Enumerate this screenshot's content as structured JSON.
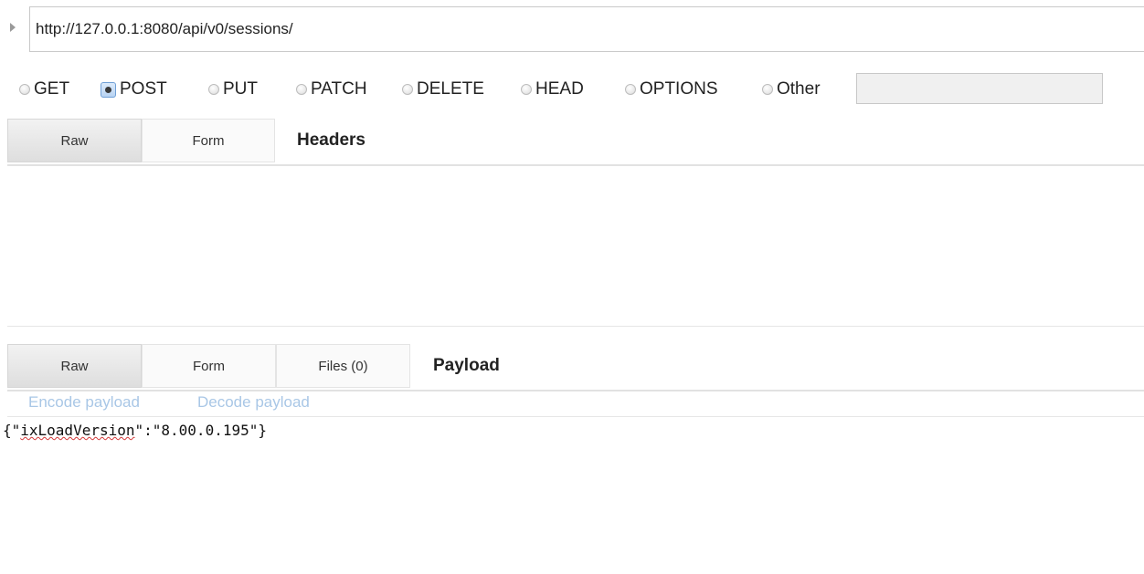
{
  "url": {
    "value": "http://127.0.0.1:8080/api/v0/sessions/"
  },
  "methods": {
    "items": [
      {
        "label": "GET",
        "selected": false
      },
      {
        "label": "POST",
        "selected": true
      },
      {
        "label": "PUT",
        "selected": false
      },
      {
        "label": "PATCH",
        "selected": false
      },
      {
        "label": "DELETE",
        "selected": false
      },
      {
        "label": "HEAD",
        "selected": false
      },
      {
        "label": "OPTIONS",
        "selected": false
      },
      {
        "label": "Other",
        "selected": false
      }
    ],
    "other_value": ""
  },
  "headers": {
    "tabs": [
      "Raw",
      "Form"
    ],
    "active_tab": "Raw",
    "title": "Headers"
  },
  "payload": {
    "tabs": [
      "Raw",
      "Form",
      "Files (0)"
    ],
    "active_tab": "Raw",
    "title": "Payload",
    "encode_label": "Encode payload",
    "decode_label": "Decode payload",
    "body_prefix": "{\"",
    "body_key": "ixLoadVersion",
    "body_suffix": "\":\"8.00.0.195\"}"
  },
  "colors": {
    "link": "#a9c7e6",
    "radio_checked": "#6f9fd6"
  },
  "icons": {
    "expand": "triangle-right-icon"
  }
}
